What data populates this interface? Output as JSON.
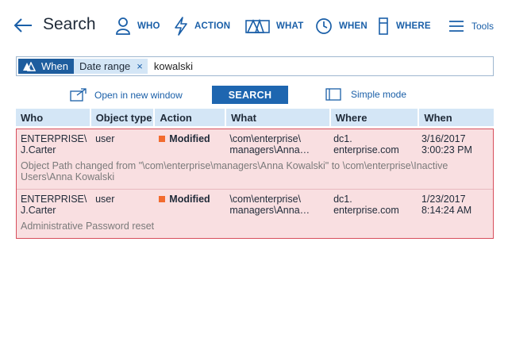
{
  "header": {
    "title": "Search",
    "nav": [
      {
        "label": "WHO",
        "icon": "person-icon"
      },
      {
        "label": "ACTION",
        "icon": "lightning-icon"
      },
      {
        "label": "WHAT",
        "icon": "object-shapes-icon"
      },
      {
        "label": "WHEN",
        "icon": "clock-icon"
      },
      {
        "label": "WHERE",
        "icon": "server-icon"
      },
      {
        "label": "Tools",
        "icon": "hamburger-menu-icon"
      }
    ]
  },
  "search": {
    "chip_when": "When",
    "chip_range": "Date range",
    "chip_close": "×",
    "value": "kowalski"
  },
  "actions": {
    "open_new_window": "Open in new window",
    "search_button": "SEARCH",
    "simple_mode": "Simple mode"
  },
  "table": {
    "columns": [
      "Who",
      "Object type",
      "Action",
      "What",
      "Where",
      "When"
    ],
    "rows": [
      {
        "who": [
          "ENTERPRISE\\",
          "J.Carter"
        ],
        "object_type": "user",
        "action": "Modified",
        "what": [
          "\\com\\enterprise\\",
          "managers\\Anna…"
        ],
        "where": [
          "dc1.",
          "enterprise.com"
        ],
        "when": [
          "3/16/2017",
          "3:00:23 PM"
        ],
        "detail": "Object Path changed from \"\\com\\enterprise\\managers\\Anna Kowalski\" to \\com\\enterprise\\Inactive Users\\Anna Kowalski"
      },
      {
        "who": [
          "ENTERPRISE\\",
          "J.Carter"
        ],
        "object_type": "user",
        "action": "Modified",
        "what": [
          "\\com\\enterprise\\",
          "managers\\Anna…"
        ],
        "where": [
          "dc1.",
          "enterprise.com"
        ],
        "when": [
          "1/23/2017",
          "8:14:24 AM"
        ],
        "detail": "Administrative Password reset"
      }
    ]
  },
  "colors": {
    "accent": "#1a5fa8",
    "chip_when_bg": "#1e5d9e",
    "chip_range_bg": "#d4e6f6",
    "row_highlight": "#f9dfe1",
    "row_border": "#d74e5c",
    "status_modified": "#f26b2f"
  }
}
